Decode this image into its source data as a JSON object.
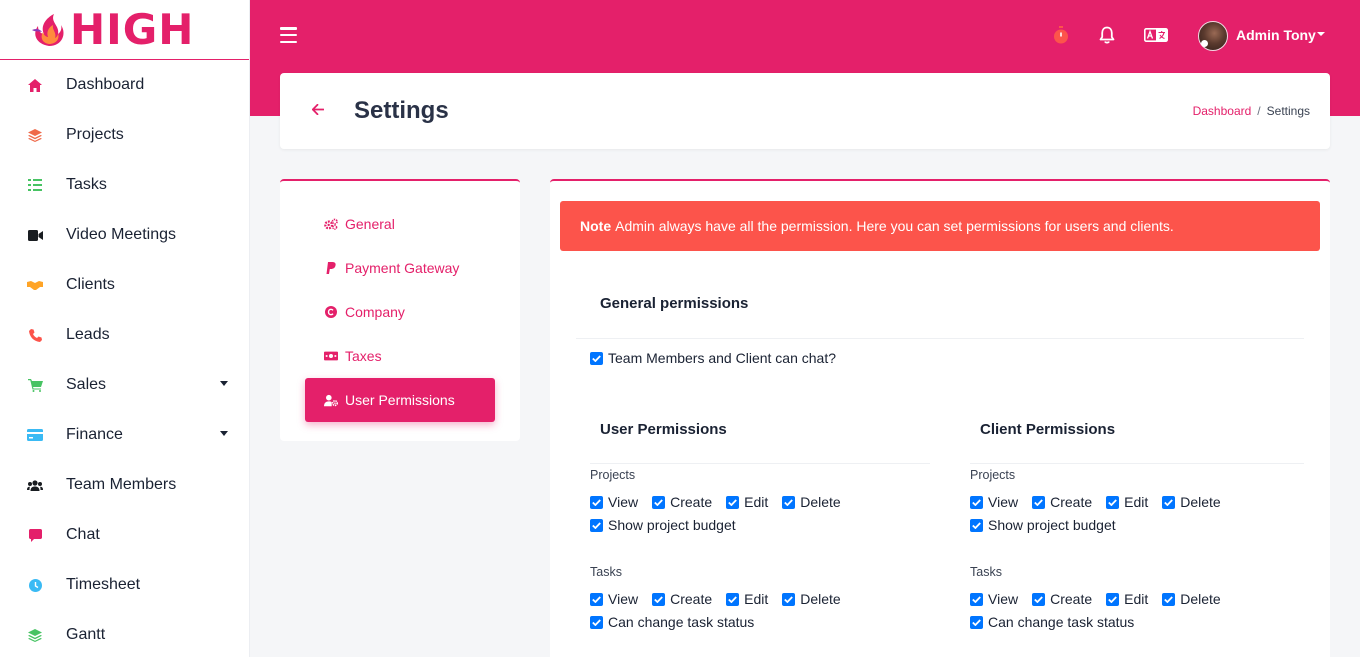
{
  "brand": {
    "logo_text": "HIGH",
    "accent": "#e4206a"
  },
  "sidebar": {
    "items": [
      {
        "label": "Dashboard",
        "icon": "home-icon",
        "color": "#e4206a",
        "has_caret": false
      },
      {
        "label": "Projects",
        "icon": "layers-icon",
        "color": "#ef6a4a",
        "has_caret": false
      },
      {
        "label": "Tasks",
        "icon": "checklist-icon",
        "color": "#47c363",
        "has_caret": false
      },
      {
        "label": "Video Meetings",
        "icon": "video-camera-icon",
        "color": "#191d21",
        "has_caret": false
      },
      {
        "label": "Clients",
        "icon": "handshake-icon",
        "color": "#ffa426",
        "has_caret": false
      },
      {
        "label": "Leads",
        "icon": "phone-icon",
        "color": "#fc544b",
        "has_caret": false
      },
      {
        "label": "Sales",
        "icon": "cart-icon",
        "color": "#47c363",
        "has_caret": true
      },
      {
        "label": "Finance",
        "icon": "credit-card-icon",
        "color": "#3abaf4",
        "has_caret": true
      },
      {
        "label": "Team Members",
        "icon": "users-icon",
        "color": "#191d21",
        "has_caret": false
      },
      {
        "label": "Chat",
        "icon": "chat-icon",
        "color": "#e4206a",
        "has_caret": false
      },
      {
        "label": "Timesheet",
        "icon": "clock-icon",
        "color": "#3abaf4",
        "has_caret": false
      },
      {
        "label": "Gantt",
        "icon": "layers-icon",
        "color": "#47c363",
        "has_caret": false
      }
    ]
  },
  "topbar": {
    "user_name": "Admin Tony",
    "timer_color": "#fc544b"
  },
  "header": {
    "title": "Settings",
    "breadcrumb": {
      "home": "Dashboard",
      "separator": "/",
      "current": "Settings"
    }
  },
  "settings_menu": {
    "items": [
      {
        "label": "General",
        "icon": "cogs-icon",
        "active": false
      },
      {
        "label": "Payment Gateway",
        "icon": "paypal-icon",
        "active": false
      },
      {
        "label": "Company",
        "icon": "copyright-icon",
        "active": false
      },
      {
        "label": "Taxes",
        "icon": "money-bill-icon",
        "active": false
      },
      {
        "label": "User Permissions",
        "icon": "user-cog-icon",
        "active": true
      }
    ]
  },
  "permissions": {
    "note_bold": "Note",
    "note_text": "Admin always have all the permission. Here you can set permissions for users and clients.",
    "general": {
      "title": "General permissions",
      "chat_label": "Team Members and Client can chat?",
      "chat_checked": true
    },
    "user": {
      "title": "User Permissions",
      "projects_label": "Projects",
      "projects": {
        "view": "View",
        "create": "Create",
        "edit": "Edit",
        "delete": "Delete",
        "budget": "Show project budget"
      },
      "tasks_label": "Tasks",
      "tasks": {
        "view": "View",
        "create": "Create",
        "edit": "Edit",
        "delete": "Delete",
        "status": "Can change task status"
      }
    },
    "client": {
      "title": "Client Permissions",
      "projects_label": "Projects",
      "projects": {
        "view": "View",
        "create": "Create",
        "edit": "Edit",
        "delete": "Delete",
        "budget": "Show project budget"
      },
      "tasks_label": "Tasks",
      "tasks": {
        "view": "View",
        "create": "Create",
        "edit": "Edit",
        "delete": "Delete",
        "status": "Can change task status"
      }
    }
  }
}
